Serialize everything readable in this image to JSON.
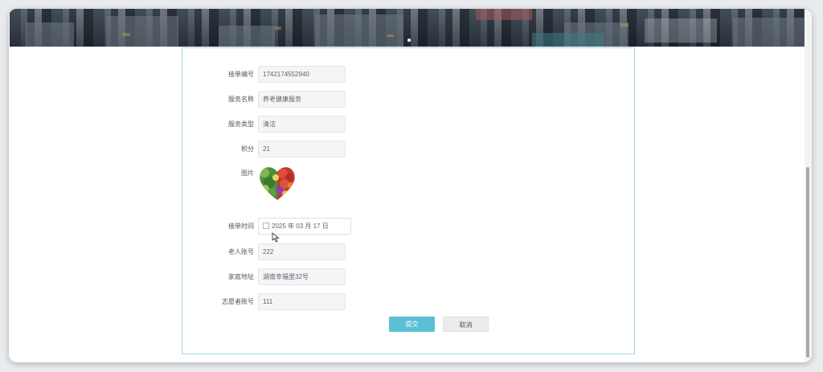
{
  "form": {
    "fields": {
      "order_no": {
        "label": "接单编号",
        "value": "1742174552940"
      },
      "service_name": {
        "label": "服务名称",
        "value": "养老健康服务"
      },
      "service_type": {
        "label": "服务类型",
        "value": "清洁"
      },
      "points": {
        "label": "积分",
        "value": "21"
      },
      "image": {
        "label": "图片",
        "icon": "heart-vegetables-image"
      },
      "order_time": {
        "label": "接单时间",
        "value": "2025 年 03 月 17 日",
        "icon": "calendar-icon"
      },
      "elder_account": {
        "label": "老人账号",
        "value": "222"
      },
      "home_address": {
        "label": "家庭地址",
        "value": "湖南幸福里32号"
      },
      "volunteer_account": {
        "label": "志愿者账号",
        "value": "111"
      }
    },
    "buttons": {
      "submit": "提交",
      "cancel": "取消"
    }
  },
  "colors": {
    "accent": "#5bc0d6",
    "panel_border": "#9fd6e0"
  }
}
